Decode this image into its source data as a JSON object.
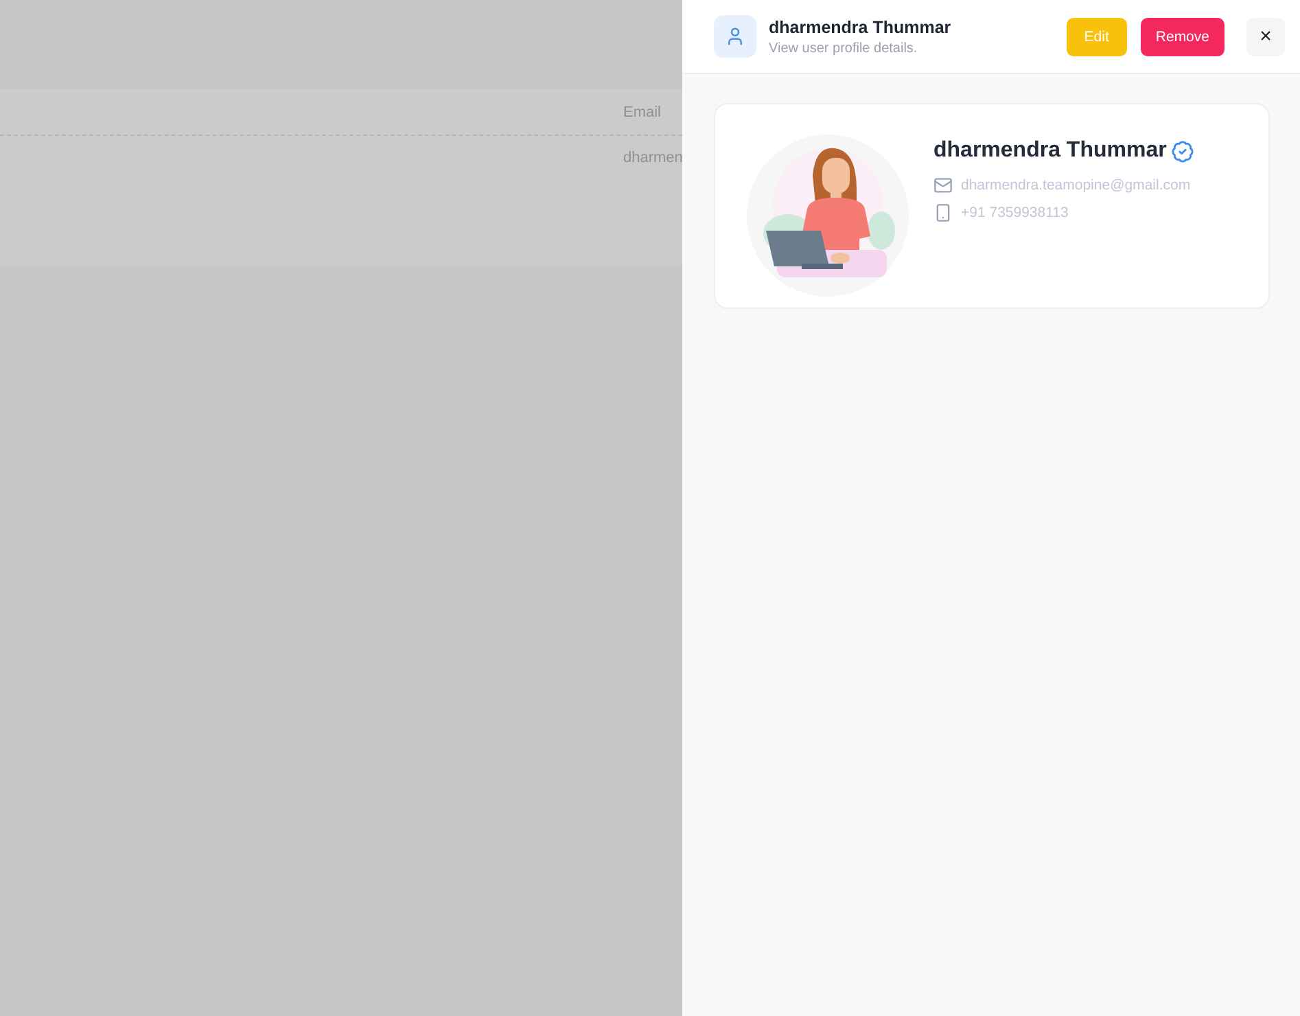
{
  "background_table": {
    "columns": [
      {
        "label": "Email"
      }
    ],
    "rows": [
      {
        "email": "dharmen"
      }
    ]
  },
  "drawer": {
    "title": "dharmendra Thummar",
    "subtitle": "View user profile details.",
    "buttons": [
      {
        "label": "Edit",
        "kind": "edit"
      },
      {
        "label": "Remove",
        "kind": "remove"
      }
    ],
    "close": "×",
    "profile": {
      "name": "dharmendra Thummar",
      "verified": true,
      "email": "dharmendra.teamopine@gmail.com",
      "phone": "+91 7359938113"
    }
  }
}
